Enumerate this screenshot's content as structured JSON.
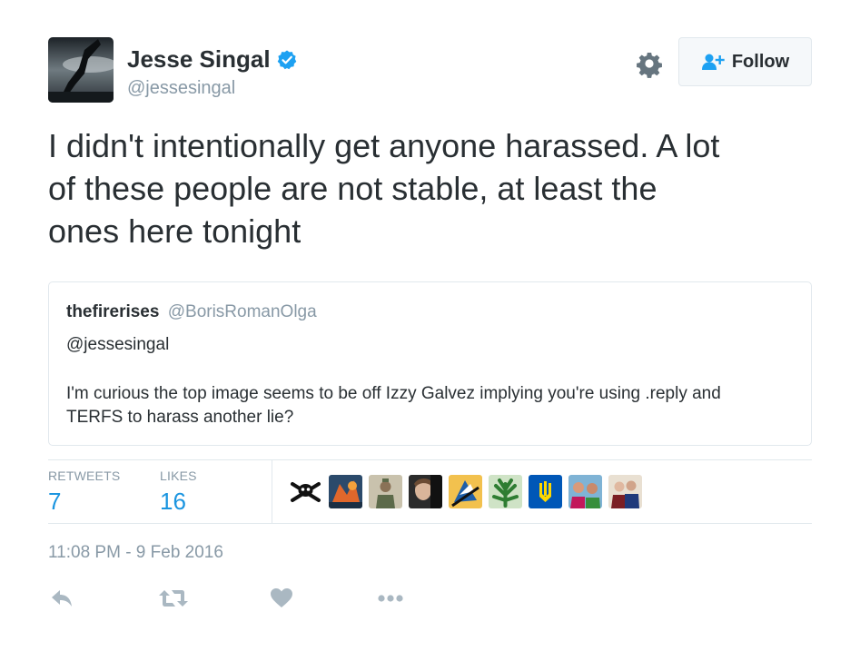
{
  "author": {
    "name": "Jesse Singal",
    "handle": "@jessesingal",
    "verified": true
  },
  "header": {
    "follow_label": "Follow"
  },
  "tweet": {
    "lines": [
      "I didn't intentionally get anyone harassed. A lot",
      "of these people are not stable, at least the",
      "ones here tonight"
    ]
  },
  "quoted": {
    "name": "thefirerises",
    "handle": "@BorisRomanOlga",
    "mention": "@jessesingal",
    "body_lines": [
      "I'm curious the top image seems to be off Izzy Galvez implying you're using .reply and",
      "TERFS to harass another lie?"
    ]
  },
  "stats": {
    "retweets_label": "RETWEETS",
    "retweets": "7",
    "likes_label": "LIKES",
    "likes": "16"
  },
  "timestamp": "11:08 PM - 9 Feb 2016",
  "icons": {
    "verified": "verified-badge-icon",
    "settings": "gear-icon",
    "follow": "add-user-icon",
    "reply": "reply-icon",
    "retweet": "retweet-icon",
    "like": "heart-icon",
    "more": "more-icon"
  },
  "colors": {
    "accent": "#1b95e0",
    "verified": "#1da1f2",
    "text": "#292f33",
    "muted": "#8899a6",
    "action_icon": "#aab8c2"
  }
}
